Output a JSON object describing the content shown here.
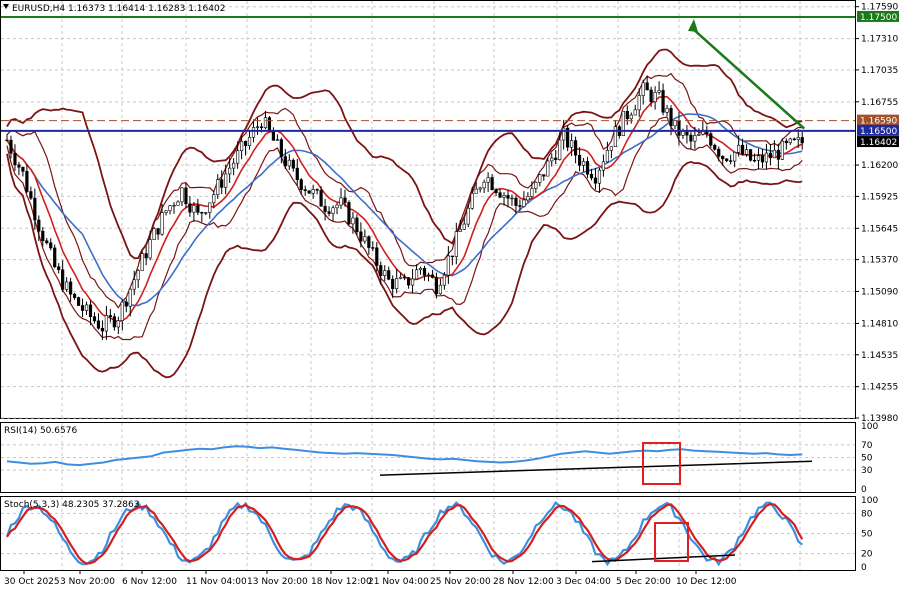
{
  "header": {
    "symbol": "EURUSD,H4",
    "ohlc": "1.16373 1.16414 1.16283 1.16402"
  },
  "price_axis": {
    "ticks": [
      "1.17590",
      "1.17310",
      "1.17035",
      "1.16755",
      "1.16200",
      "1.15925",
      "1.15645",
      "1.15370",
      "1.15090",
      "1.14810",
      "1.14535",
      "1.14255",
      "1.13980"
    ],
    "tick_values": [
      1.1759,
      1.1731,
      1.17035,
      1.16755,
      1.162,
      1.15925,
      1.15645,
      1.1537,
      1.1509,
      1.1481,
      1.14535,
      1.14255,
      1.1398
    ],
    "range": [
      1.1398,
      1.1764
    ],
    "labels": {
      "target": {
        "text": "1.17500",
        "value": 1.175,
        "color": "#1a7a1a"
      },
      "dashed": {
        "text": "1.16590",
        "value": 1.1659,
        "color": "#a0522d"
      },
      "level": {
        "text": "1.16500",
        "value": 1.165,
        "color": "#1f2a9e"
      },
      "current": {
        "text": "1.16402",
        "value": 1.16402,
        "color": "#000000"
      }
    }
  },
  "rsi": {
    "title": "RSI(14) 50.6576",
    "ticks": [
      "100",
      "70",
      "50",
      "30",
      "0"
    ],
    "tick_values": [
      100,
      70,
      50,
      30,
      0
    ],
    "series_color": "#3c8fe0",
    "values": [
      44,
      42,
      40,
      41,
      43,
      39,
      38,
      40,
      42,
      46,
      48,
      50,
      52,
      58,
      60,
      62,
      64,
      63,
      66,
      68,
      67,
      65,
      66,
      64,
      62,
      60,
      58,
      57,
      56,
      57,
      56,
      55,
      54,
      52,
      50,
      48,
      47,
      48,
      46,
      44,
      43,
      42,
      43,
      45,
      48,
      52,
      56,
      58,
      60,
      58,
      56,
      58,
      60,
      61,
      60,
      62,
      63,
      61,
      60,
      59,
      58,
      57,
      56,
      57,
      55,
      54,
      55
    ]
  },
  "stoch": {
    "title": "Stoch(5,3,3) 48.2305 37.2863",
    "ticks": [
      "100",
      "80",
      "50",
      "20",
      "0"
    ],
    "tick_values": [
      100,
      80,
      50,
      20,
      0
    ],
    "main_color": "#3c8fe0",
    "signal_color": "#d21f1f"
  },
  "time_axis": {
    "labels": [
      "30 Oct 2025",
      "3 Nov 20:00",
      "6 Nov 12:00",
      "11 Nov 04:00",
      "13 Nov 20:00",
      "18 Nov 12:00",
      "21 Nov 04:00",
      "25 Nov 20:00",
      "28 Nov 12:00",
      "3 Dec 04:00",
      "5 Dec 20:00",
      "10 Dec 12:00"
    ]
  },
  "colors": {
    "candles": "#000000",
    "bollinger": "#7a1414",
    "ma_fast": "#d21f1f",
    "ma_slow": "#3c6fc8",
    "arrow": "#1a7a1a",
    "highlight_box": "#e02020",
    "trendline": "#000000"
  },
  "chart_data": {
    "type": "line",
    "title": "EURUSD,H4",
    "series": [
      {
        "name": "EURUSD,H4",
        "x_index": [
          0,
          4,
          8,
          12,
          16,
          20,
          24,
          28,
          32,
          36,
          40,
          44,
          48,
          52,
          56,
          60,
          64,
          68,
          72,
          76,
          80,
          84,
          88,
          92,
          96,
          100,
          104,
          108,
          112,
          116,
          120,
          124,
          128,
          132,
          136,
          140,
          144,
          148,
          152,
          156,
          160,
          164,
          168,
          172,
          176,
          180,
          184,
          188,
          192,
          196,
          200
        ],
        "values": [
          1.1642,
          1.1612,
          1.1568,
          1.153,
          1.1505,
          1.149,
          1.1478,
          1.1488,
          1.152,
          1.1552,
          1.158,
          1.1598,
          1.1575,
          1.1595,
          1.1618,
          1.1638,
          1.166,
          1.1635,
          1.1612,
          1.1598,
          1.1585,
          1.1585,
          1.1565,
          1.154,
          1.1518,
          1.1515,
          1.153,
          1.1515,
          1.1545,
          1.158,
          1.1612,
          1.1598,
          1.1585,
          1.1595,
          1.162,
          1.1645,
          1.1625,
          1.1612,
          1.1642,
          1.1665,
          1.1685,
          1.1678,
          1.1652,
          1.164,
          1.1648,
          1.1628,
          1.1632,
          1.1622,
          1.1628,
          1.1635,
          1.164
        ]
      }
    ],
    "ylim": [
      1.1398,
      1.1764
    ]
  }
}
